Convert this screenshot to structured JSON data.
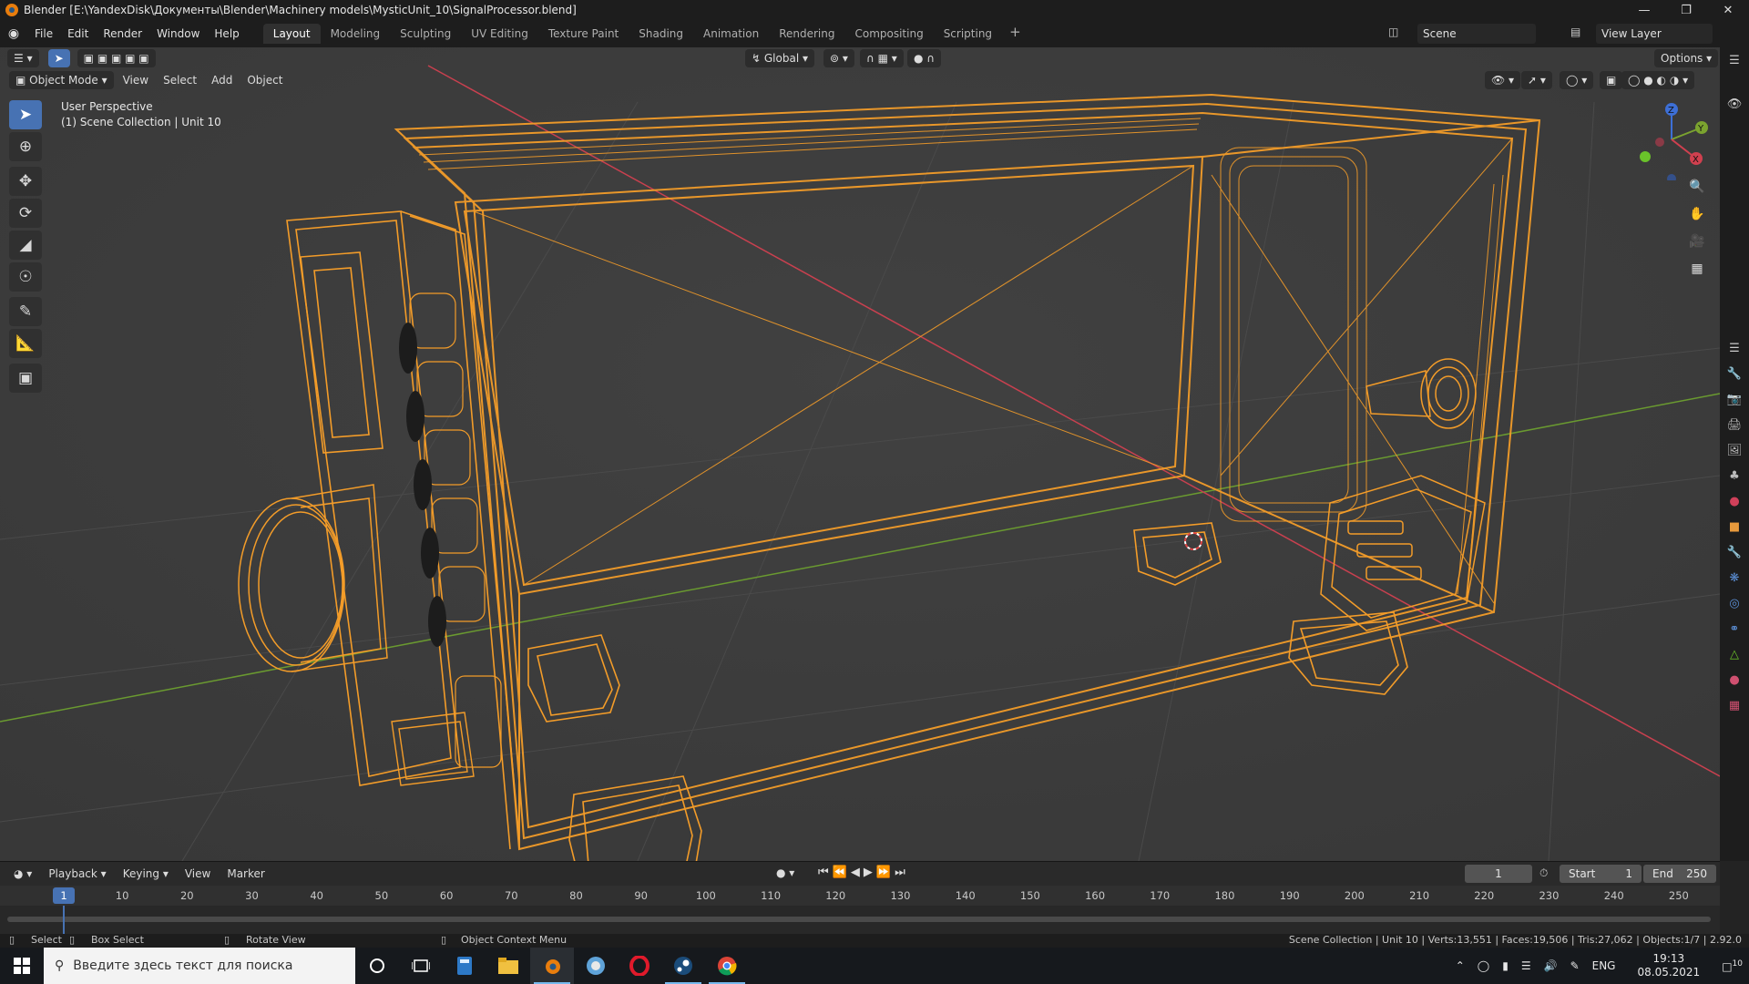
{
  "window": {
    "title": "Blender [E:\\YandexDisk\\Документы\\Blender\\Machinery models\\MysticUnit_10\\SignalProcessor.blend]",
    "controls": [
      "minimize-icon",
      "restore-icon",
      "close-icon"
    ]
  },
  "menubar": {
    "items": [
      "File",
      "Edit",
      "Render",
      "Window",
      "Help"
    ]
  },
  "workspaces": {
    "tabs": [
      "Layout",
      "Modeling",
      "Sculpting",
      "UV Editing",
      "Texture Paint",
      "Shading",
      "Animation",
      "Rendering",
      "Compositing",
      "Scripting"
    ],
    "active": "Layout"
  },
  "scene": {
    "name": "Scene",
    "view_layer": "View Layer"
  },
  "tool_header": {
    "transform_orientation": "Global",
    "options_label": "Options"
  },
  "viewport_header": {
    "mode": "Object Mode",
    "menus": [
      "View",
      "Select",
      "Add",
      "Object"
    ]
  },
  "viewport_info": {
    "perspective": "User Perspective",
    "collection": "(1) Scene Collection | Unit 10"
  },
  "toolbar_tools": [
    "select-box-icon",
    "cursor-icon",
    "move-icon",
    "rotate-icon",
    "scale-icon",
    "transform-icon",
    "annotate-icon",
    "measure-icon",
    "add-cube-icon"
  ],
  "gizmo": {
    "axes": [
      "X",
      "Y",
      "Z"
    ]
  },
  "colors": {
    "wire_selected": "#f39c29",
    "axis_x": "#c9404f",
    "axis_y": "#6a9a30",
    "accent": "#4772b3",
    "viewport_bg": "#3d3d3d"
  },
  "timeline": {
    "menus": [
      "Playback",
      "Keying",
      "View",
      "Marker"
    ],
    "current_frame": "1",
    "start_label": "Start",
    "start": "1",
    "end_label": "End",
    "end": "250",
    "ticks": [
      "10",
      "20",
      "30",
      "40",
      "50",
      "60",
      "70",
      "80",
      "90",
      "100",
      "110",
      "120",
      "130",
      "140",
      "150",
      "160",
      "170",
      "180",
      "190",
      "200",
      "210",
      "220",
      "230",
      "240",
      "250"
    ]
  },
  "statusbar": {
    "select": "Select",
    "box_select": "Box Select",
    "rotate_view": "Rotate View",
    "context_menu": "Object Context Menu",
    "stats": "Scene Collection | Unit 10 | Verts:13,551 | Faces:19,506 | Tris:27,062 | Objects:1/7 | 2.92.0"
  },
  "taskbar": {
    "search_placeholder": "Введите здесь текст для поиска",
    "apps": [
      "cortana-icon",
      "task-view-icon",
      "calculator-icon",
      "file-explorer-icon",
      "blender-icon",
      "browser-icon",
      "opera-icon",
      "steam-icon",
      "chrome-icon"
    ],
    "language": "ENG",
    "time": "19:13",
    "date": "08.05.2021",
    "notifications": "10"
  }
}
